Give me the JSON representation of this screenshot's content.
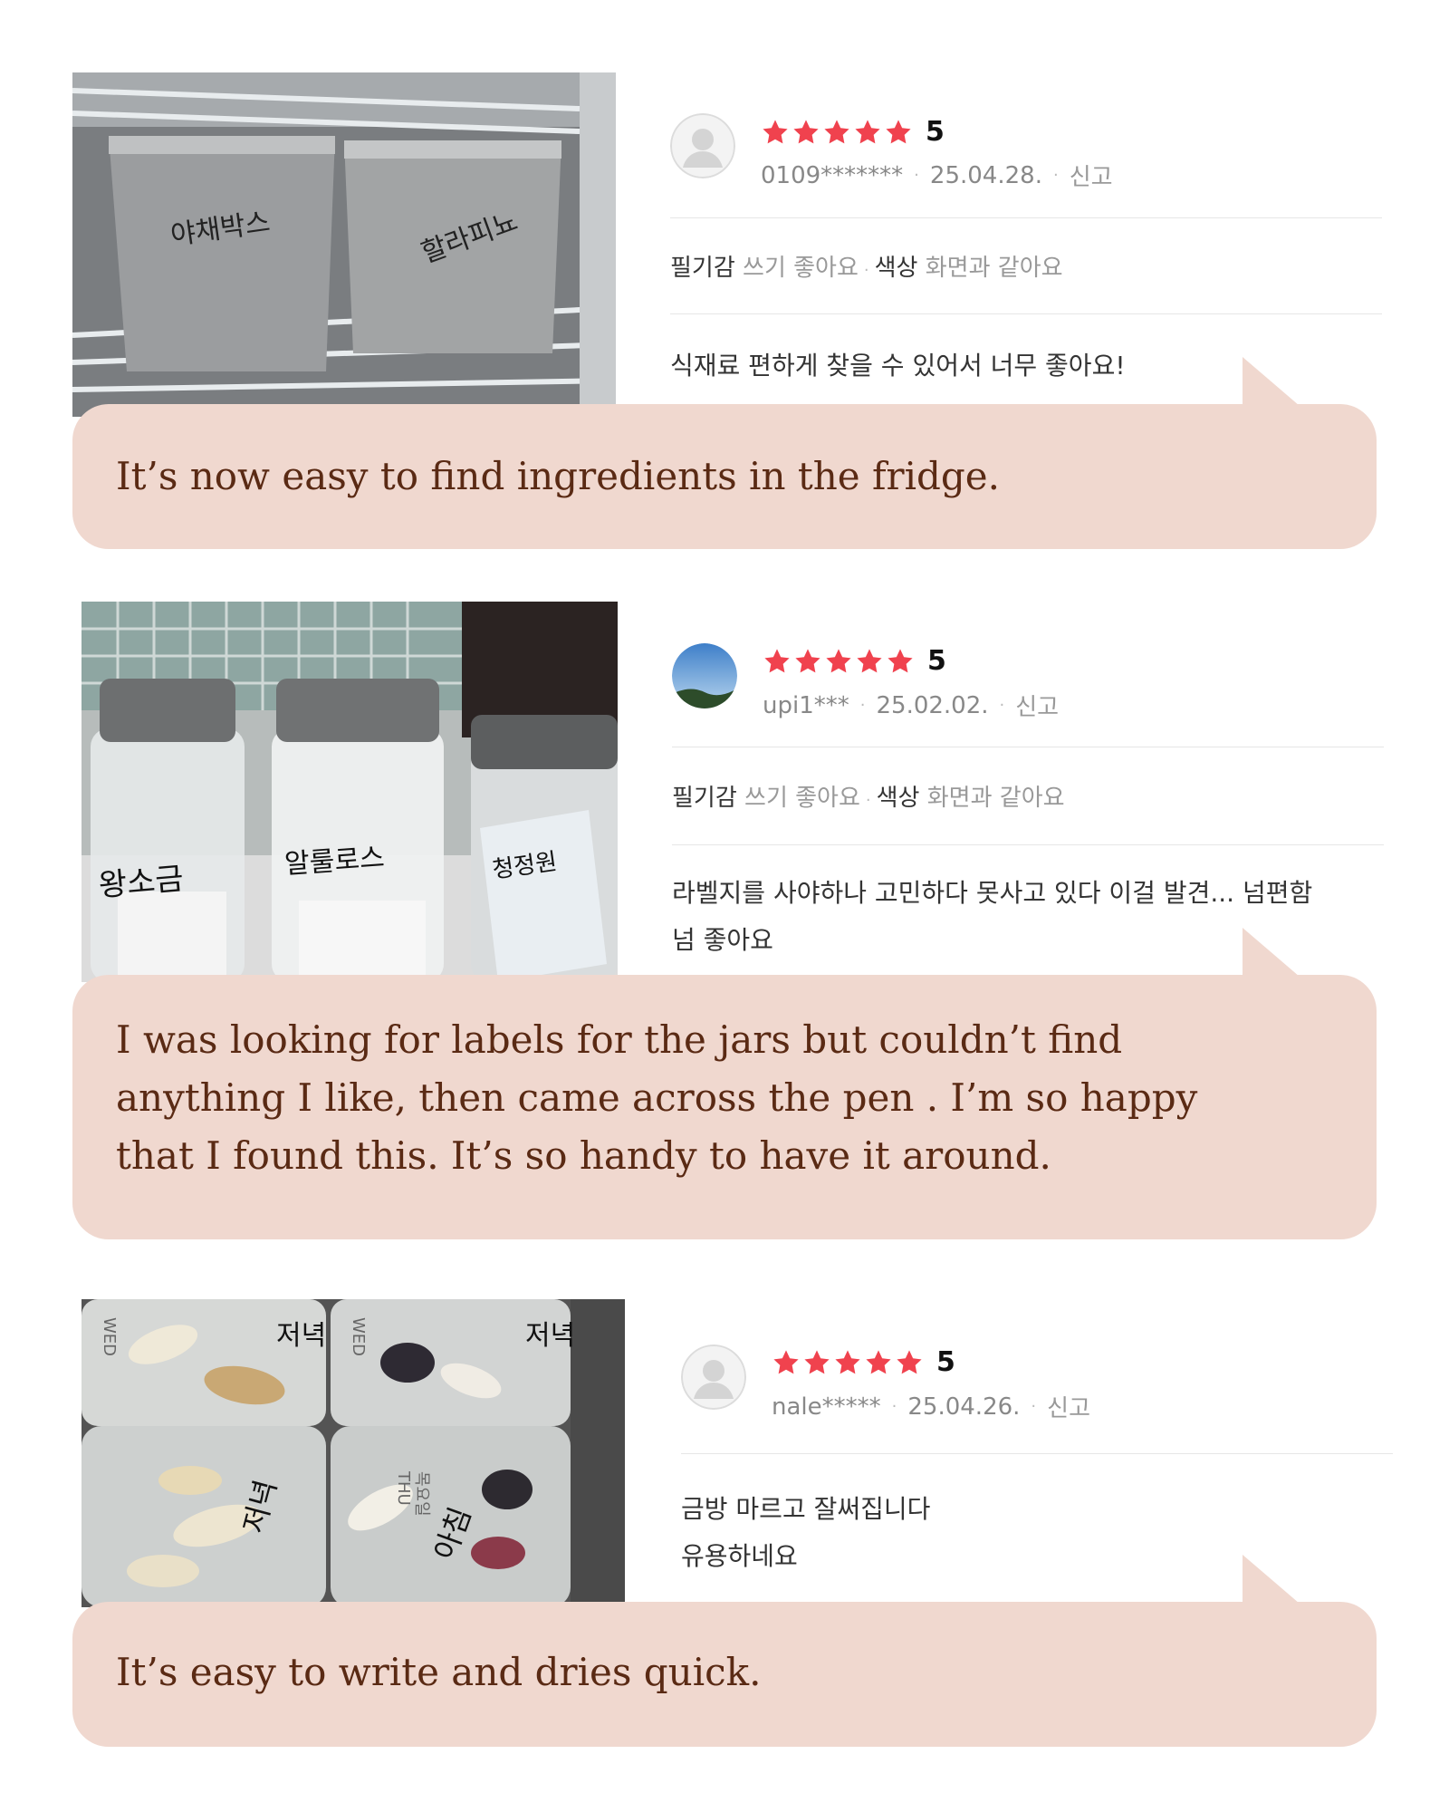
{
  "reviews": [
    {
      "rating": "5",
      "user": "0109*******",
      "date": "25.04.28.",
      "report": "신고",
      "tag1_key": "필기감",
      "tag1_val": "쓰기 좋아요",
      "tag2_key": "색상",
      "tag2_val": "화면과 같아요",
      "text": "식재료 편하게 찾을 수 있어서 너무 좋아요!",
      "translation": "It’s now easy to find ingredients in the fridge.",
      "photo_labels": [
        "야채박스",
        "할라피뇨"
      ]
    },
    {
      "rating": "5",
      "user": "upi1***",
      "date": "25.02.02.",
      "report": "신고",
      "tag1_key": "필기감",
      "tag1_val": "쓰기 좋아요",
      "tag2_key": "색상",
      "tag2_val": "화면과 같아요",
      "text_line1": "라벨지를 사야하나 고민하다 못사고 있다 이걸 발견... 넘편함",
      "text_line2": "넘 좋아요",
      "translation": "I was looking for labels for the jars but couldn’t find\nanything I like, then came across the pen . I’m so happy\nthat I found this. It’s so handy to have it around.",
      "photo_labels": [
        "왕소금",
        "알룰로스",
        "청정원"
      ]
    },
    {
      "rating": "5",
      "user": "nale*****",
      "date": "25.04.26.",
      "report": "신고",
      "text_line1": "금방 마르고 잘써집니다",
      "text_line2": "유용하네요",
      "translation": "It’s easy to write and dries quick.",
      "photo_labels": [
        "저녁",
        "아침",
        "WED",
        "THU",
        "목요일"
      ]
    }
  ],
  "colors": {
    "star": "#f0424e",
    "bubble": "#f0d8cf",
    "bubble_text": "#5a2a14"
  },
  "icons": [
    "star-icon",
    "avatar-icon"
  ]
}
